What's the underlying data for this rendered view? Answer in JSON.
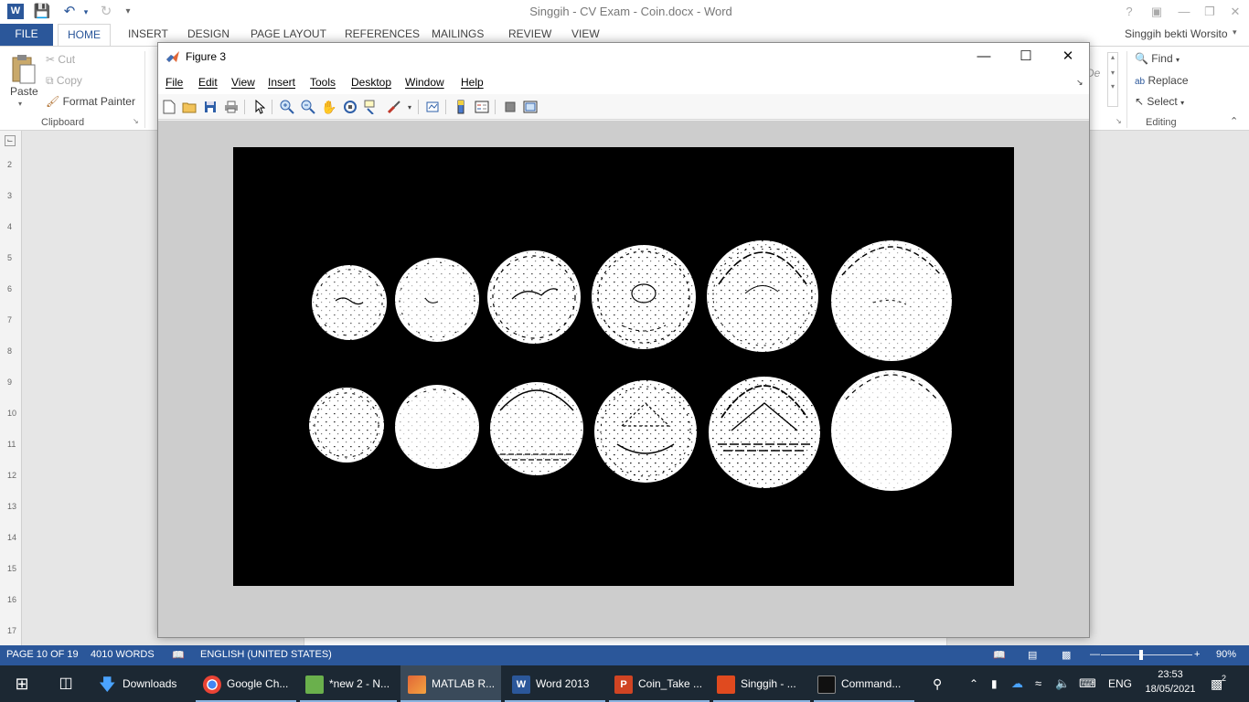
{
  "word": {
    "title": "Singgih - CV Exam - Coin.docx - Word",
    "user": "Singgih bekti Worsito",
    "tabs": [
      "FILE",
      "HOME",
      "INSERT",
      "DESIGN",
      "PAGE LAYOUT",
      "REFERENCES",
      "MAILINGS",
      "REVIEW",
      "VIEW"
    ],
    "clipboard": {
      "paste": "Paste",
      "cut": "Cut",
      "copy": "Copy",
      "format_painter": "Format Painter",
      "group_label": "Clipboard"
    },
    "editing": {
      "find": "Find",
      "replace": "Replace",
      "select": "Select",
      "group_label": "Editing"
    },
    "ruler_numbers": [
      "2",
      "3",
      "4",
      "5",
      "6",
      "7",
      "8",
      "9",
      "10",
      "11",
      "12",
      "13",
      "14",
      "15",
      "16",
      "17"
    ],
    "status": {
      "page": "PAGE 10 OF 19",
      "words": "4010 WORDS",
      "language": "ENGLISH (UNITED STATES)",
      "zoom": "90%"
    },
    "accent_color": "#2b579a"
  },
  "figure": {
    "title": "Figure 3",
    "menu": [
      "File",
      "Edit",
      "View",
      "Insert",
      "Tools",
      "Desktop",
      "Window",
      "Help"
    ],
    "toolbar_icons": [
      "new-figure-icon",
      "open-file-icon",
      "save-icon",
      "print-icon",
      "edit-plot-icon",
      "zoom-in-icon",
      "zoom-out-icon",
      "pan-icon",
      "rotate-3d-icon",
      "data-cursor-icon",
      "brush-icon",
      "link-plot-icon",
      "insert-colorbar-icon",
      "insert-legend-icon",
      "hide-plot-tools-icon",
      "show-plot-tools-icon"
    ]
  },
  "taskbar": {
    "items": [
      "Downloads",
      "Google Ch...",
      "*new 2 - N...",
      "MATLAB R...",
      "Word 2013",
      "Coin_Take ...",
      "Singgih - ...",
      "Command..."
    ],
    "language": "ENG",
    "time": "23:53",
    "date": "18/05/2021",
    "notifications": "2"
  }
}
